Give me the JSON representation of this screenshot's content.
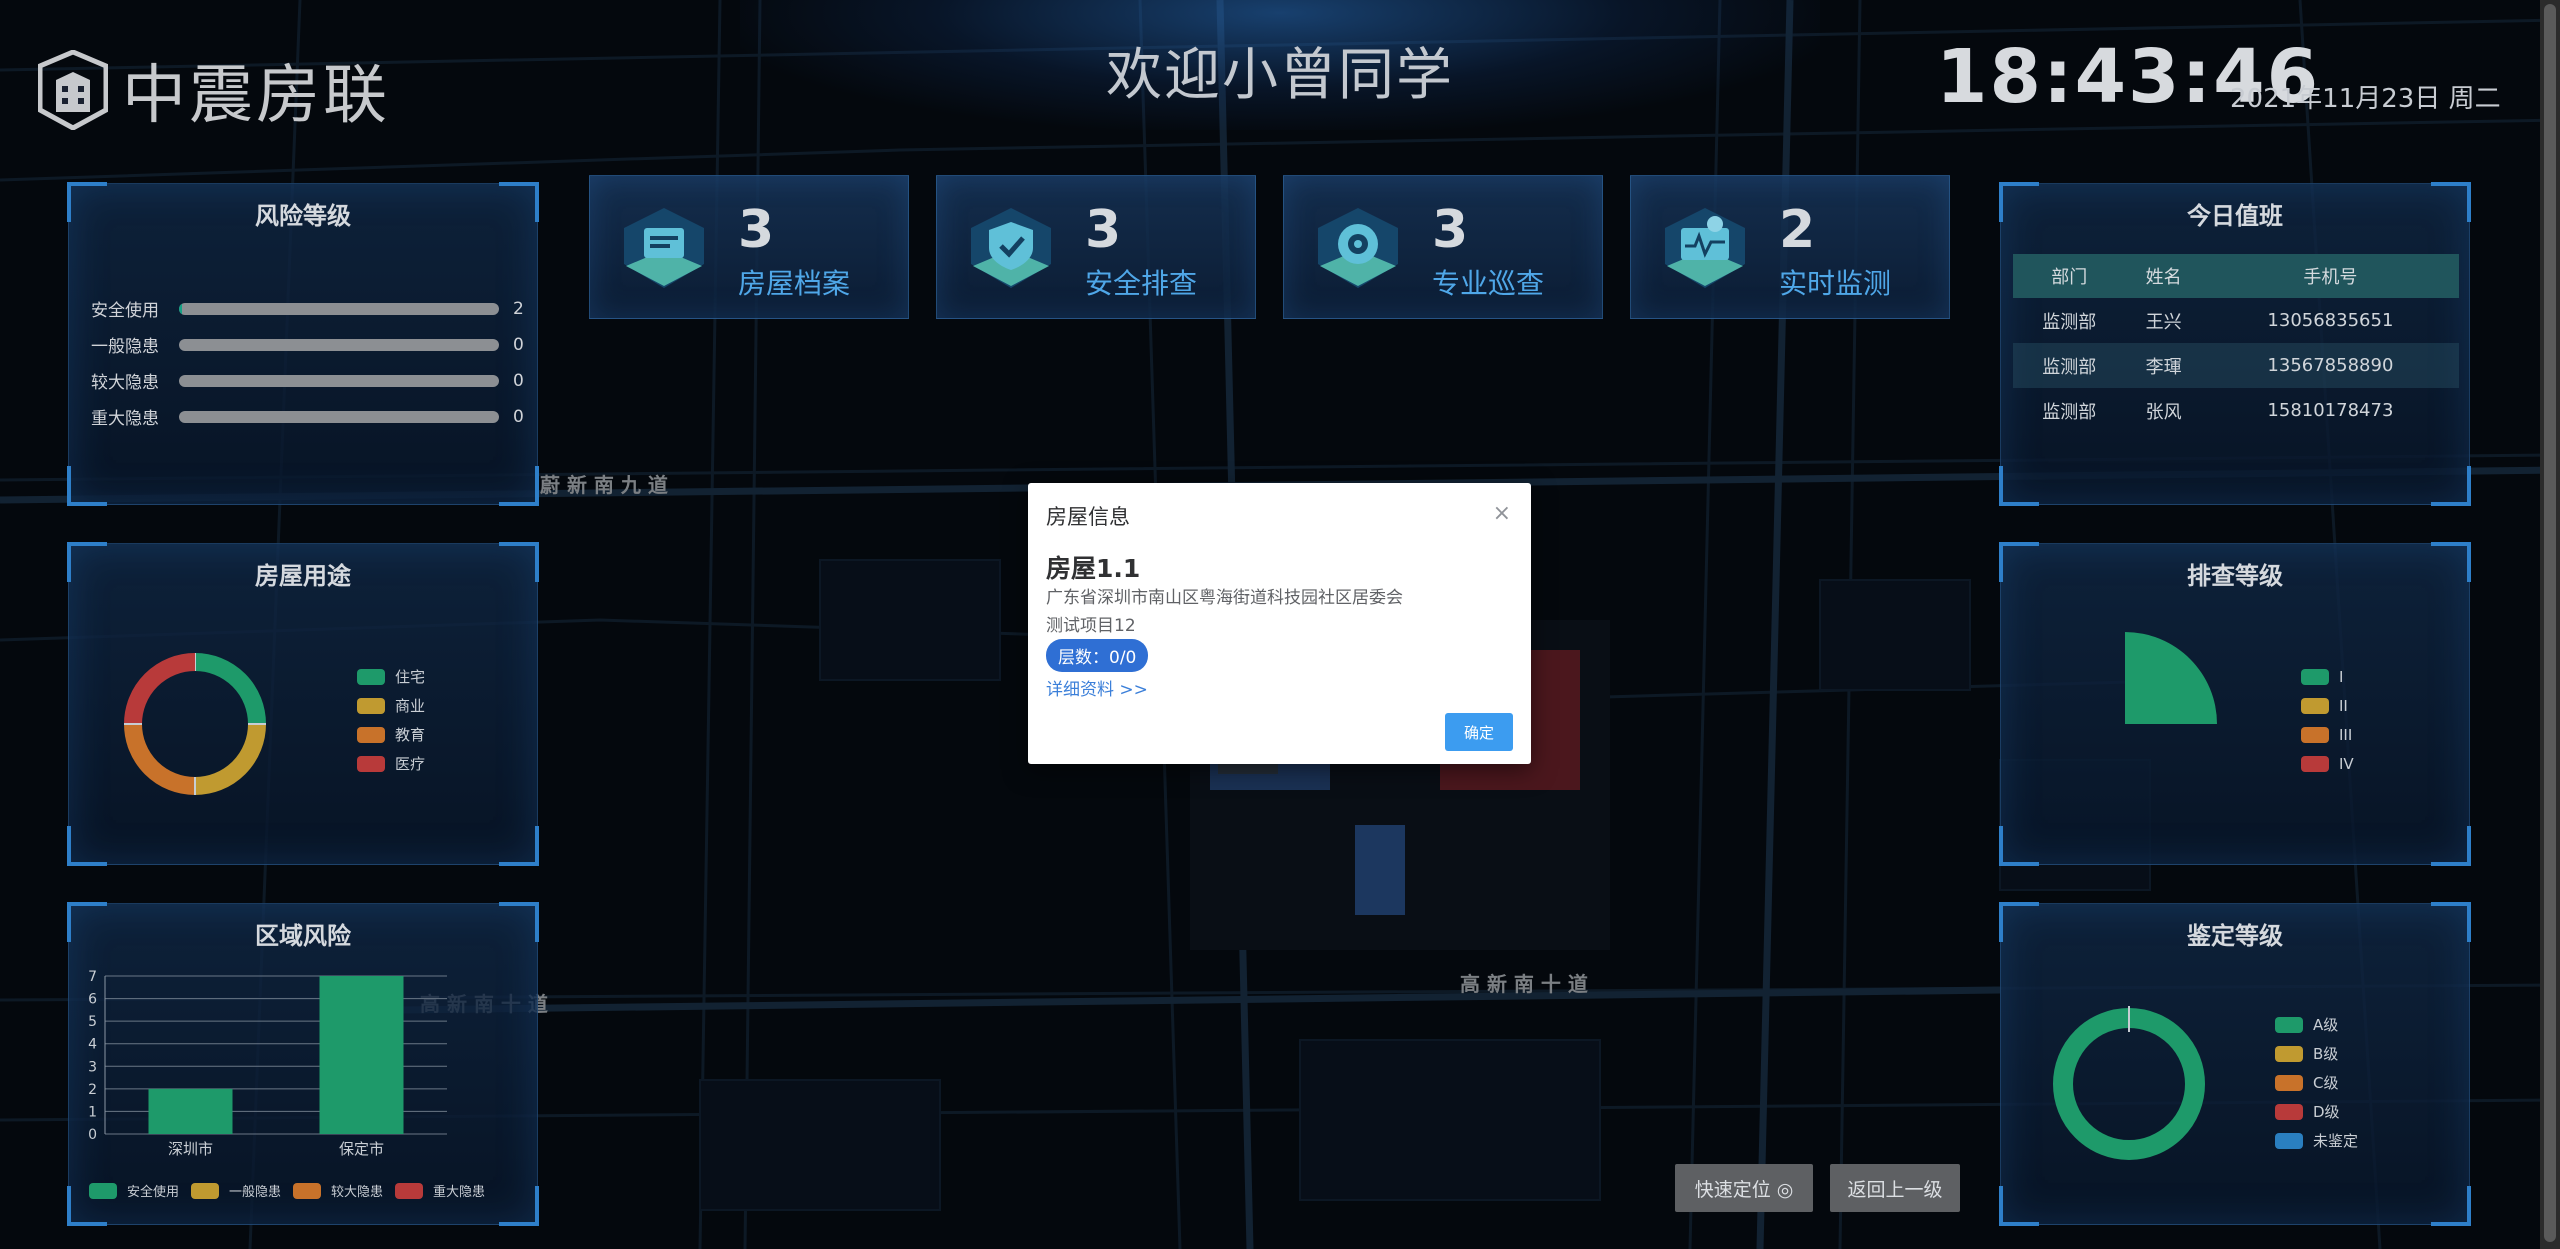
{
  "header": {
    "logo_text": "中震房联",
    "welcome": "欢迎小曾同学",
    "time": "18:43:46",
    "date": "2021年11月23日 周二"
  },
  "risk_level": {
    "title": "风险等级",
    "rows": [
      {
        "label": "安全使用",
        "value": 2,
        "fraction": 0.01
      },
      {
        "label": "一般隐患",
        "value": 0,
        "fraction": 0
      },
      {
        "label": "较大隐患",
        "value": 0,
        "fraction": 0
      },
      {
        "label": "重大隐患",
        "value": 0,
        "fraction": 0
      }
    ]
  },
  "house_use": {
    "title": "房屋用途",
    "legend": [
      "住宅",
      "商业",
      "教育",
      "医疗"
    ],
    "colors": [
      "#1e9a6a",
      "#c09a30",
      "#c8722a",
      "#b83a3a"
    ],
    "values": [
      1,
      1,
      1,
      1
    ]
  },
  "region_risk": {
    "title": "区域风险",
    "legend": [
      "安全使用",
      "一般隐患",
      "较大隐患",
      "重大隐患"
    ],
    "colors": [
      "#1e9a6a",
      "#c09a30",
      "#c8722a",
      "#b83a3a"
    ]
  },
  "chart_data": [
    {
      "type": "bar",
      "title": "区域风险",
      "categories": [
        "深圳市",
        "保定市"
      ],
      "series": [
        {
          "name": "安全使用",
          "values": [
            2,
            7
          ]
        },
        {
          "name": "一般隐患",
          "values": [
            0,
            0
          ]
        },
        {
          "name": "较大隐患",
          "values": [
            0,
            0
          ]
        },
        {
          "name": "重大隐患",
          "values": [
            0,
            0
          ]
        }
      ],
      "ylim": [
        0,
        7
      ],
      "yticks": [
        "0",
        "1",
        "2",
        "3",
        "4",
        "5",
        "6",
        "7"
      ],
      "grid": true,
      "legend_position": "bottom"
    },
    {
      "type": "pie",
      "title": "房屋用途",
      "categories": [
        "住宅",
        "商业",
        "教育",
        "医疗"
      ],
      "values": [
        1,
        1,
        1,
        1
      ],
      "legend_position": "right"
    },
    {
      "type": "pie",
      "title": "排查等级",
      "categories": [
        "I",
        "II",
        "III",
        "IV"
      ],
      "values": [
        1,
        0,
        0,
        0
      ],
      "legend_position": "right"
    },
    {
      "type": "pie",
      "title": "鉴定等级",
      "categories": [
        "A级",
        "B级",
        "C级",
        "D级",
        "未鉴定"
      ],
      "values": [
        1,
        0,
        0,
        0,
        0
      ],
      "legend_position": "right"
    }
  ],
  "stat_cards": [
    {
      "number": "3",
      "label": "房屋档案"
    },
    {
      "number": "3",
      "label": "安全排查"
    },
    {
      "number": "3",
      "label": "专业巡查"
    },
    {
      "number": "2",
      "label": "实时监测"
    }
  ],
  "duty": {
    "title": "今日值班",
    "columns": [
      "部门",
      "姓名",
      "手机号"
    ],
    "rows": [
      [
        "监测部",
        "王兴",
        "13056835651"
      ],
      [
        "监测部",
        "李琿",
        "13567858890"
      ],
      [
        "监测部",
        "张风",
        "15810178473"
      ]
    ]
  },
  "inspection_level": {
    "title": "排查等级",
    "legend": [
      "I",
      "II",
      "III",
      "IV"
    ],
    "colors": [
      "#1e9a6a",
      "#c09a30",
      "#c8722a",
      "#b83a3a"
    ]
  },
  "appraisal_level": {
    "title": "鉴定等级",
    "legend": [
      "A级",
      "B级",
      "C级",
      "D级",
      "未鉴定"
    ],
    "colors": [
      "#1e9a6a",
      "#c09a30",
      "#c8722a",
      "#b83a3a",
      "#2a7fc0"
    ]
  },
  "modal": {
    "title": "房屋信息",
    "close": "×",
    "house_name": "房屋1.1",
    "address": "广东省深圳市南山区粤海街道科技园社区居委会",
    "project": "测试项目12",
    "floors": "层数：0/0",
    "detail_link": "详细资料 >>",
    "confirm": "确定"
  },
  "map_controls": {
    "locate": "快速定位 ◎",
    "back": "返回上一级"
  }
}
